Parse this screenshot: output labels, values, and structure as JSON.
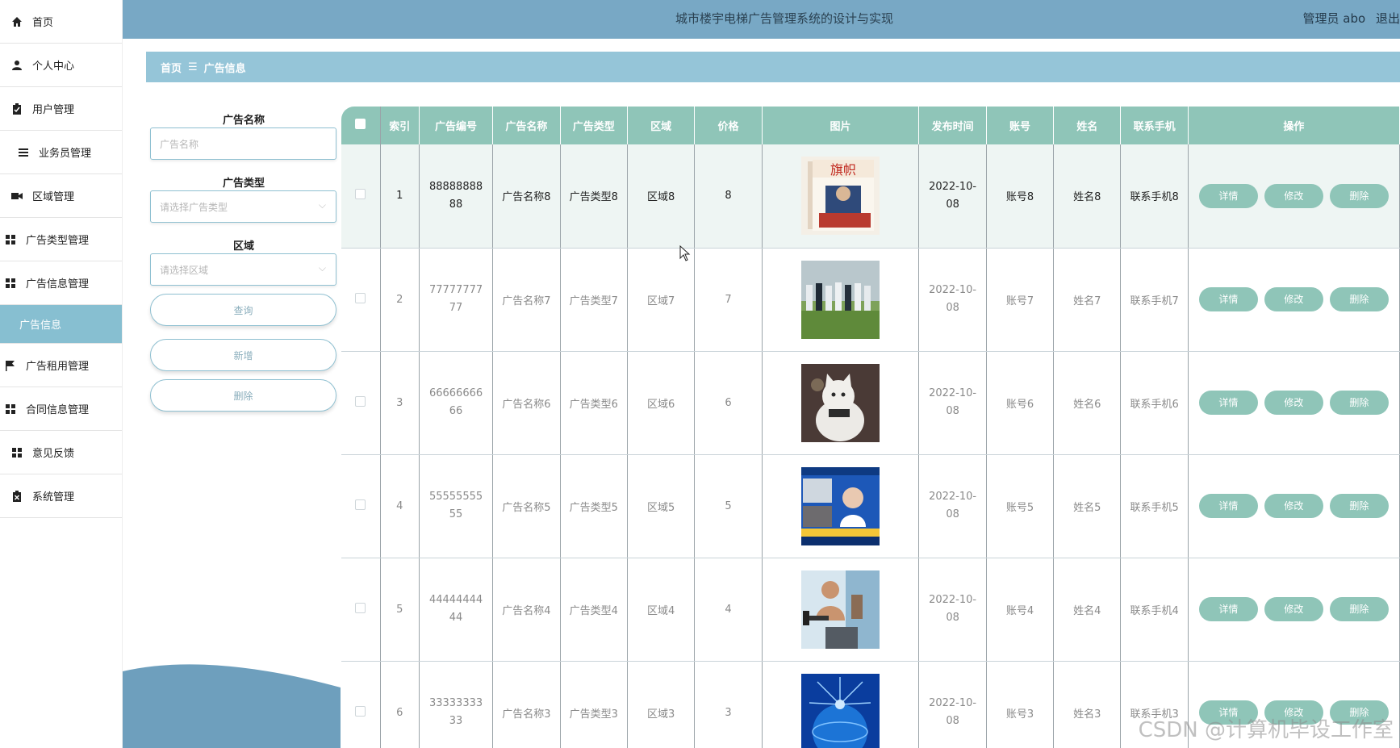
{
  "sidebar": {
    "items": [
      {
        "label": "首页",
        "icon": "home-icon"
      },
      {
        "label": "个人中心",
        "icon": "user-icon"
      },
      {
        "label": "用户管理",
        "icon": "clipboard-icon"
      },
      {
        "label": "业务员管理",
        "icon": "list-icon"
      },
      {
        "label": "区域管理",
        "icon": "video-icon"
      },
      {
        "label": "广告类型管理",
        "icon": "grid-icon"
      },
      {
        "label": "广告信息管理",
        "icon": "grid-icon"
      },
      {
        "label": "广告信息",
        "icon": ""
      },
      {
        "label": "广告租用管理",
        "icon": "flag-icon"
      },
      {
        "label": "合同信息管理",
        "icon": "grid-icon"
      },
      {
        "label": "意见反馈",
        "icon": "grid-icon"
      },
      {
        "label": "系统管理",
        "icon": "clipboard-icon"
      }
    ]
  },
  "header": {
    "title": "城市楼宇电梯广告管理系统的设计与实现",
    "user": "管理员 abo",
    "logout": "退出"
  },
  "breadcrumb": {
    "home": "首页",
    "separator": "☰",
    "current": "广告信息"
  },
  "search": {
    "name_label": "广告名称",
    "name_placeholder": "广告名称",
    "type_label": "广告类型",
    "type_placeholder": "请选择广告类型",
    "area_label": "区域",
    "area_placeholder": "请选择区域",
    "query_button": "查询",
    "add_button": "新增",
    "delete_button": "删除"
  },
  "table": {
    "headers": [
      "索引",
      "广告编号",
      "广告名称",
      "广告类型",
      "区域",
      "价格",
      "图片",
      "发布时间",
      "账号",
      "姓名",
      "联系手机",
      "操作"
    ],
    "rows": [
      {
        "index": "1",
        "code": "8888888888",
        "name": "广告名称8",
        "type": "广告类型8",
        "area": "区域8",
        "price": "8",
        "date": "2022-10-08",
        "account": "账号8",
        "person": "姓名8",
        "phone": "联系手机8"
      },
      {
        "index": "2",
        "code": "7777777777",
        "name": "广告名称7",
        "type": "广告类型7",
        "area": "区域7",
        "price": "7",
        "date": "2022-10-08",
        "account": "账号7",
        "person": "姓名7",
        "phone": "联系手机7"
      },
      {
        "index": "3",
        "code": "6666666666",
        "name": "广告名称6",
        "type": "广告类型6",
        "area": "区域6",
        "price": "6",
        "date": "2022-10-08",
        "account": "账号6",
        "person": "姓名6",
        "phone": "联系手机6"
      },
      {
        "index": "4",
        "code": "5555555555",
        "name": "广告名称5",
        "type": "广告类型5",
        "area": "区域5",
        "price": "5",
        "date": "2022-10-08",
        "account": "账号5",
        "person": "姓名5",
        "phone": "联系手机5"
      },
      {
        "index": "5",
        "code": "4444444444",
        "name": "广告名称4",
        "type": "广告类型4",
        "area": "区域4",
        "price": "4",
        "date": "2022-10-08",
        "account": "账号4",
        "person": "姓名4",
        "phone": "联系手机4"
      },
      {
        "index": "6",
        "code": "3333333333",
        "name": "广告名称3",
        "type": "广告类型3",
        "area": "区域3",
        "price": "3",
        "date": "2022-10-08",
        "account": "账号3",
        "person": "姓名3",
        "phone": "联系手机3"
      }
    ],
    "actions": {
      "detail": "详情",
      "edit": "修改",
      "delete": "删除"
    }
  },
  "watermark": "CSDN @计算机毕设工作室",
  "colors": {
    "topbar": "#78a8c5",
    "breadcrumb": "#95c5d8",
    "table_header": "#8fc5b8",
    "sidebar_active": "#87bfd1"
  }
}
